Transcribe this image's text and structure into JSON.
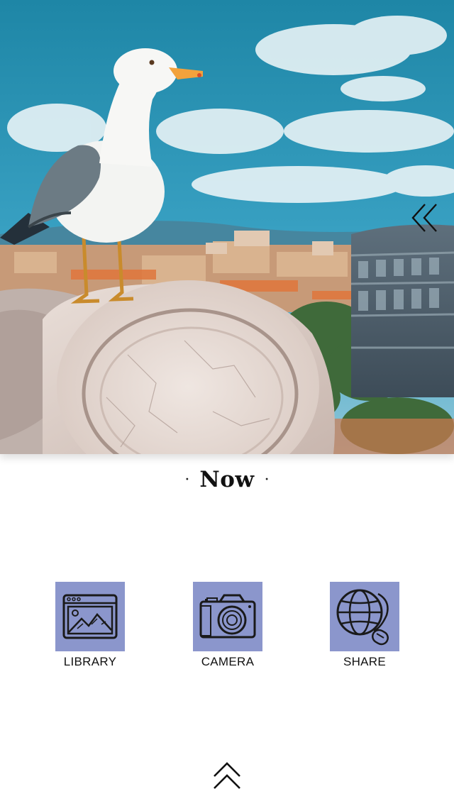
{
  "hero": {
    "image_subject": "seagull-on-stone-column-rome-colosseum",
    "back_icon": "double-chevron-left-icon"
  },
  "header": {
    "title": "Now",
    "dot_left": "·",
    "dot_right": "·"
  },
  "actions": [
    {
      "label": "LIBRARY",
      "icon": "gallery-picture-icon"
    },
    {
      "label": "CAMERA",
      "icon": "camera-icon"
    },
    {
      "label": "SHARE",
      "icon": "globe-mouse-icon"
    }
  ],
  "footer": {
    "expand_icon": "double-chevron-up-icon"
  },
  "colors": {
    "tile_background": "#8b96cc",
    "icon_stroke": "#1a1a1a",
    "background": "#ffffff"
  }
}
